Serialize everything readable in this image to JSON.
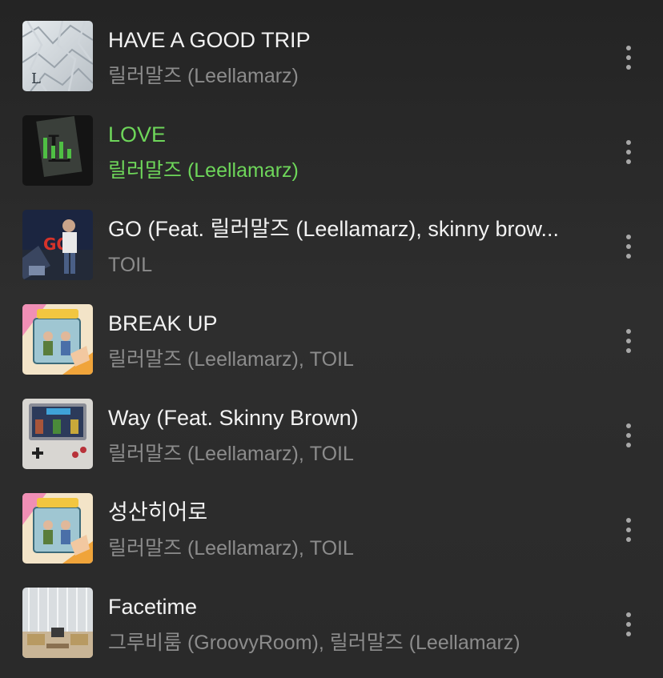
{
  "tracks": [
    {
      "title": "HAVE A GOOD TRIP",
      "artist": "릴러말즈 (Leellamarz)",
      "playing": false,
      "art": "crumpled-paper-cover"
    },
    {
      "title": "LOVE",
      "artist": "릴러말즈 (Leellamarz)",
      "playing": true,
      "art": "dark-cover-with-equalizer"
    },
    {
      "title": "GO (Feat. 릴러말즈 (Leellamarz), skinny brow...",
      "artist": "TOIL",
      "playing": false,
      "art": "go-street-cover"
    },
    {
      "title": "BREAK UP",
      "artist": "릴러말즈 (Leellamarz), TOIL",
      "playing": false,
      "art": "toy-story-2-cover"
    },
    {
      "title": "Way (Feat. Skinny Brown)",
      "artist": "릴러말즈 (Leellamarz), TOIL",
      "playing": false,
      "art": "gameboy-toy-story-cover"
    },
    {
      "title": "성산히어로",
      "artist": "릴러말즈 (Leellamarz), TOIL",
      "playing": false,
      "art": "toy-story-2-cover"
    },
    {
      "title": "Facetime",
      "artist": "그루비룸 (GroovyRoom), 릴러말즈 (Leellamarz)",
      "playing": false,
      "art": "room-photo-cover"
    }
  ],
  "colors": {
    "accent": "#6ed65a",
    "title": "#f2f2f2",
    "subtitle": "#8c8c8c",
    "background": "#2a2a2a"
  },
  "icons": {
    "more": "vertical-ellipsis-icon",
    "playing": "equalizer-bars-icon"
  }
}
